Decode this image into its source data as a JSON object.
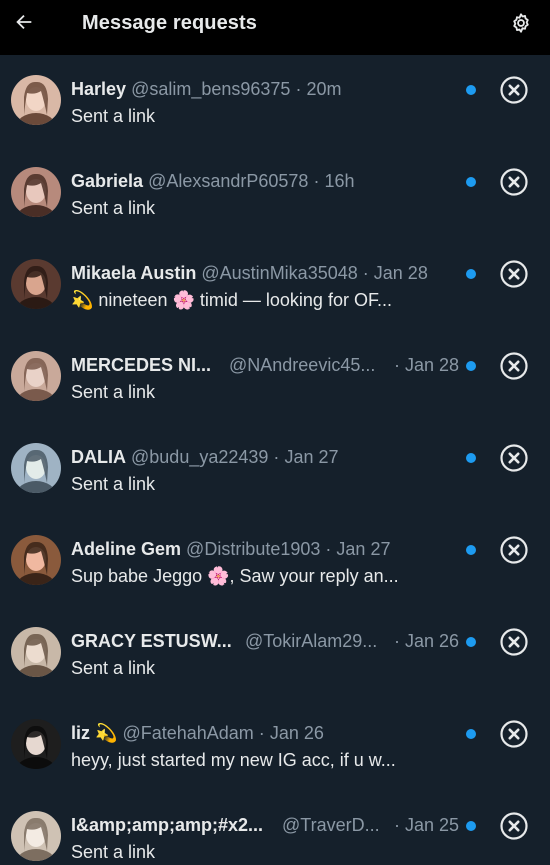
{
  "header": {
    "title": "Message requests",
    "back_icon": "arrow-left-icon",
    "settings_icon": "gear-icon"
  },
  "colors": {
    "background": "#15202b",
    "header_background": "#000000",
    "unread_dot": "#1d9bf0",
    "secondary_text": "#8b98a5"
  },
  "requests": [
    {
      "name": "Harley",
      "handle": "@salim_bens96375",
      "time": "20m",
      "preview": "Sent a link",
      "unread": true
    },
    {
      "name": "Gabriela",
      "handle": "@AlexsandrP60578",
      "time": "16h",
      "preview": "Sent a link",
      "unread": true
    },
    {
      "name": "Mikaela Austin",
      "handle": "@AustinMika35048",
      "time": "Jan 28",
      "preview": "💫 nineteen 🌸 timid — looking for OF...",
      "unread": true
    },
    {
      "name": "MERCEDES NI...",
      "handle": "@NAndreevic45...",
      "time": "Jan 28",
      "preview": "Sent a link",
      "unread": true
    },
    {
      "name": "DALIA",
      "handle": "@budu_ya22439",
      "time": "Jan 27",
      "preview": "Sent a link",
      "unread": true
    },
    {
      "name": "Adeline Gem",
      "handle": "@Distribute1903",
      "time": "Jan 27",
      "preview": "Sup babe Jeggo 🌸, Saw your reply an...",
      "unread": true
    },
    {
      "name": "GRACY ESTUSW...",
      "handle": "@TokirAlam29...",
      "time": "Jan 26",
      "preview": "Sent a link",
      "unread": true
    },
    {
      "name": "liz 💫",
      "handle": "@FatehahAdam",
      "time": "Jan 26",
      "preview": "heyy, just started my new IG acc, if u w...",
      "unread": true
    },
    {
      "name": "I&amp;amp;amp;#x2...",
      "handle": "@TraverD...",
      "time": "Jan 25",
      "preview": "Sent a link",
      "unread": true
    }
  ],
  "labels": {
    "separator": "·"
  }
}
